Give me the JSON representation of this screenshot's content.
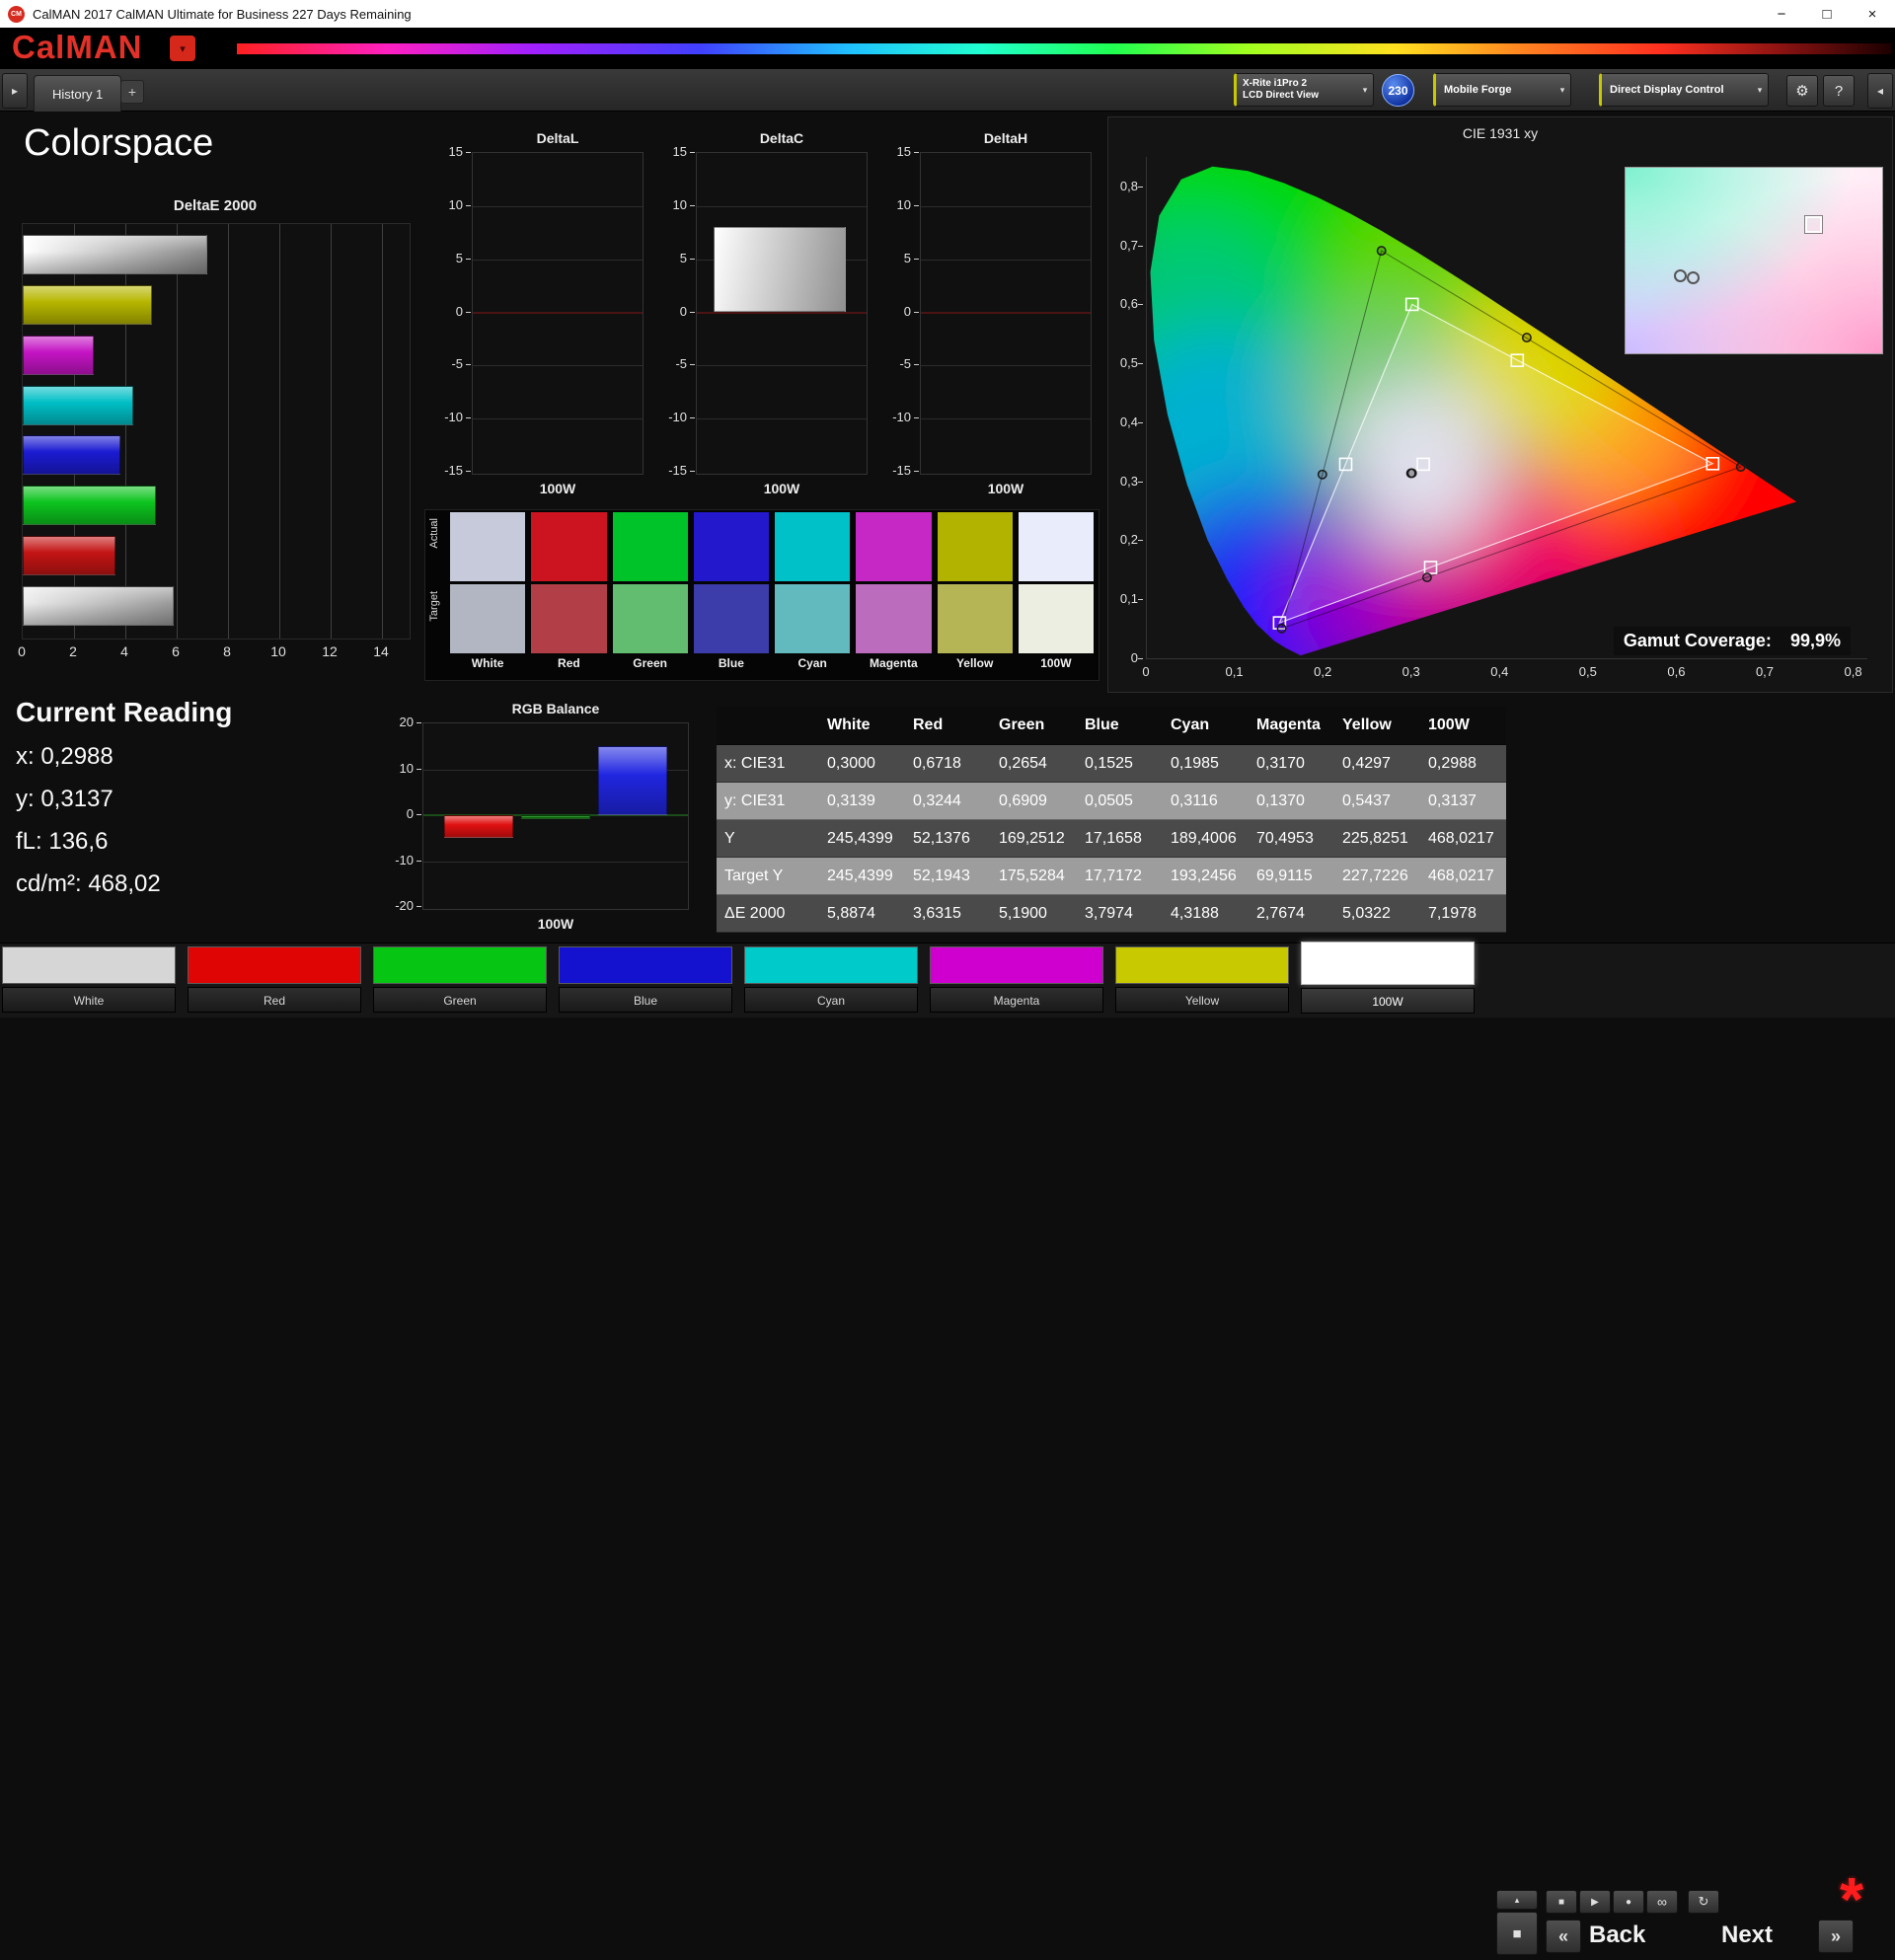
{
  "window": {
    "title": "CalMAN 2017 CalMAN Ultimate for Business 227 Days Remaining",
    "app_icon_text": "CM"
  },
  "logo": {
    "text": "CalMAN"
  },
  "tab_bar": {
    "active_tab": "History 1",
    "add_tab": "+"
  },
  "toolbar": {
    "meter_line1": "X-Rite i1Pro 2",
    "meter_line2": "LCD Direct View",
    "meter_badge": "230",
    "source": "Mobile Forge",
    "display_control": "Direct Display Control"
  },
  "icons": {
    "dropdown": "▾",
    "expand_left": "▸",
    "expand_right": "◂",
    "gear": "⚙",
    "help": "?",
    "minimize": "−",
    "maximize": "□",
    "close": "×",
    "collapse": "▴",
    "stop_big": "■",
    "stop": "■",
    "play": "▶",
    "record": "●",
    "continuous": "∞",
    "refresh": "↻",
    "prev": "«",
    "next": "»",
    "asterisk": "*"
  },
  "page": {
    "title": "Colorspace"
  },
  "current_reading": {
    "title": "Current Reading",
    "lines": [
      "x: 0,2988",
      "y: 0,3137",
      "fL: 136,6",
      "cd/m²: 468,02"
    ]
  },
  "swatches": {
    "row_labels": [
      "Actual",
      "Target"
    ],
    "columns": [
      "White",
      "Red",
      "Green",
      "Blue",
      "Cyan",
      "Magenta",
      "Yellow",
      "100W"
    ],
    "actual_colors": [
      "#c6cada",
      "#cc1420",
      "#00c32a",
      "#2418cc",
      "#00c0c8",
      "#c628c6",
      "#b2b200",
      "#e9edfb"
    ],
    "target_colors": [
      "#b2b6c2",
      "#b23f48",
      "#62bd70",
      "#3c3caa",
      "#62babe",
      "#bc6cbc",
      "#b5b556",
      "#edeee2"
    ]
  },
  "patch_bar": {
    "patches": [
      {
        "label": "White",
        "color": "#d6d6d6",
        "active": false
      },
      {
        "label": "Red",
        "color": "#e00505",
        "active": false
      },
      {
        "label": "Green",
        "color": "#07c613",
        "active": false
      },
      {
        "label": "Blue",
        "color": "#1412cf",
        "active": false
      },
      {
        "label": "Cyan",
        "color": "#00cbcb",
        "active": false
      },
      {
        "label": "Magenta",
        "color": "#cf00cf",
        "active": false
      },
      {
        "label": "Yellow",
        "color": "#c9c900",
        "active": false
      },
      {
        "label": "100W",
        "color": "#ffffff",
        "active": true
      }
    ]
  },
  "transport": {
    "back_label": "Back",
    "next_label": "Next"
  },
  "chart_data": [
    {
      "id": "deltaE2000",
      "type": "bar",
      "orientation": "horizontal",
      "title": "DeltaE 2000",
      "xlim": [
        0,
        15
      ],
      "x_ticks": [
        0,
        2,
        4,
        6,
        8,
        10,
        12,
        14
      ],
      "categories": [
        "100W",
        "Yellow",
        "Magenta",
        "Cyan",
        "Blue",
        "Green",
        "Red",
        "White"
      ],
      "values": [
        7.1978,
        5.0322,
        2.7674,
        4.3188,
        3.7974,
        5.19,
        3.6315,
        5.8874
      ],
      "bar_colors": [
        "white-gradient",
        "#b6b600",
        "#c414c4",
        "#00bfc6",
        "#1b1bd2",
        "#0cc41e",
        "#c41414",
        "gray-gradient"
      ]
    },
    {
      "id": "deltaL",
      "type": "bar",
      "title": "DeltaL",
      "xlabel": "100W",
      "ylim": [
        -15,
        15
      ],
      "y_ticks": [
        15,
        10,
        5,
        0,
        -5,
        -10,
        -15
      ],
      "categories": [
        "100W"
      ],
      "values": [
        0.0
      ]
    },
    {
      "id": "deltaC",
      "type": "bar",
      "title": "DeltaC",
      "xlabel": "100W",
      "ylim": [
        -15,
        15
      ],
      "y_ticks": [
        15,
        10,
        5,
        0,
        -5,
        -10,
        -15
      ],
      "categories": [
        "100W"
      ],
      "values": [
        8.0
      ]
    },
    {
      "id": "deltaH",
      "type": "bar",
      "title": "DeltaH",
      "xlabel": "100W",
      "ylim": [
        -15,
        15
      ],
      "y_ticks": [
        15,
        10,
        5,
        0,
        -5,
        -10,
        -15
      ],
      "categories": [
        "100W"
      ],
      "values": [
        0.0
      ]
    },
    {
      "id": "rgbBalance",
      "type": "bar",
      "title": "RGB Balance",
      "xlabel": "100W",
      "ylim": [
        -20,
        20
      ],
      "y_ticks": [
        20,
        10,
        0,
        -10,
        -20
      ],
      "series": [
        {
          "name": "Red",
          "value": -5,
          "color": "#e01010"
        },
        {
          "name": "Green",
          "value": -0.8,
          "color": "#0a7a0a"
        },
        {
          "name": "Blue",
          "value": 15,
          "color": "#2026e0"
        }
      ]
    },
    {
      "id": "cie1931",
      "type": "scatter",
      "title": "CIE 1931 xy",
      "xlim": [
        0,
        0.815
      ],
      "ylim": [
        0,
        0.85
      ],
      "x_tick_labels": [
        "0",
        "0,1",
        "0,2",
        "0,3",
        "0,4",
        "0,5",
        "0,6",
        "0,7",
        "0,8"
      ],
      "y_tick_labels": [
        "0,8",
        "0,7",
        "0,6",
        "0,5",
        "0,4",
        "0,3",
        "0,2",
        "0,1",
        "0"
      ],
      "targets": {
        "White": [
          0.3127,
          0.329
        ],
        "Red": [
          0.64,
          0.33
        ],
        "Green": [
          0.3,
          0.6
        ],
        "Blue": [
          0.15,
          0.06
        ],
        "Cyan": [
          0.225,
          0.329
        ],
        "Magenta": [
          0.321,
          0.154
        ],
        "Yellow": [
          0.419,
          0.505
        ]
      },
      "measured": {
        "White": [
          0.3,
          0.3139
        ],
        "Red": [
          0.6718,
          0.3244
        ],
        "Green": [
          0.2654,
          0.6909
        ],
        "Blue": [
          0.1525,
          0.0505
        ],
        "Cyan": [
          0.1985,
          0.3116
        ],
        "Magenta": [
          0.317,
          0.137
        ],
        "Yellow": [
          0.4297,
          0.5437
        ],
        "100W": [
          0.2988,
          0.3137
        ]
      },
      "gamut_coverage_label": "Gamut Coverage:",
      "gamut_coverage_value": "99,9%"
    },
    {
      "id": "results",
      "type": "table",
      "headers": [
        "",
        "White",
        "Red",
        "Green",
        "Blue",
        "Cyan",
        "Magenta",
        "Yellow",
        "100W"
      ],
      "rows": [
        [
          "x: CIE31",
          "0,3000",
          "0,6718",
          "0,2654",
          "0,1525",
          "0,1985",
          "0,3170",
          "0,4297",
          "0,2988"
        ],
        [
          "y: CIE31",
          "0,3139",
          "0,3244",
          "0,6909",
          "0,0505",
          "0,3116",
          "0,1370",
          "0,5437",
          "0,3137"
        ],
        [
          "Y",
          "245,4399",
          "52,1376",
          "169,2512",
          "17,1658",
          "189,4006",
          "70,4953",
          "225,8251",
          "468,0217"
        ],
        [
          "Target Y",
          "245,4399",
          "52,1943",
          "175,5284",
          "17,7172",
          "193,2456",
          "69,9115",
          "227,7226",
          "468,0217"
        ],
        [
          "ΔE 2000",
          "5,8874",
          "3,6315",
          "5,1900",
          "3,7974",
          "4,3188",
          "2,7674",
          "5,0322",
          "7,1978"
        ]
      ]
    }
  ]
}
